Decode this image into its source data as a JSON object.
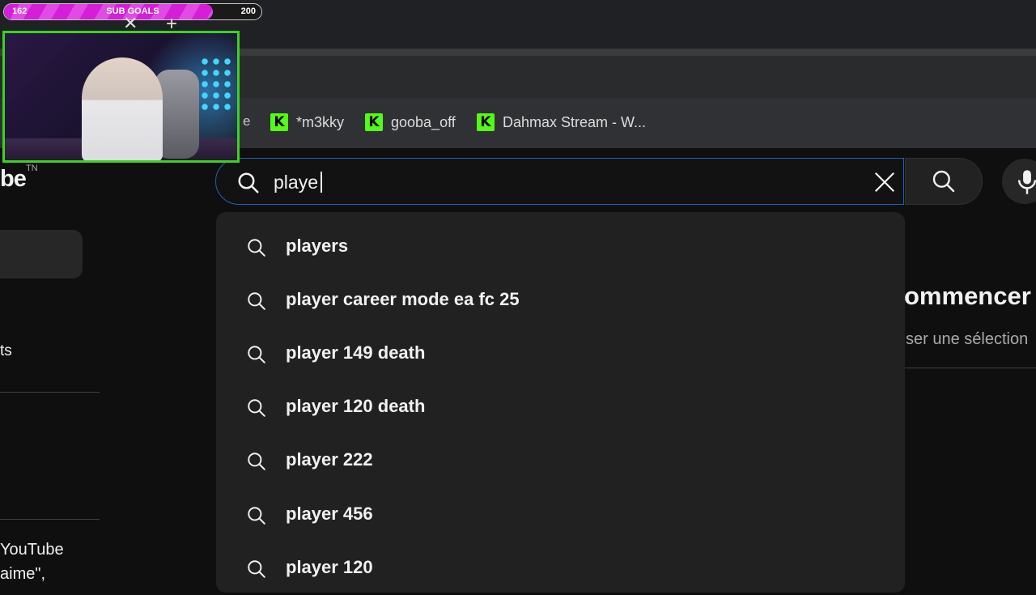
{
  "overlay": {
    "sub_goal": {
      "current": "162",
      "label": "SUB GOALS",
      "target": "200",
      "progress_fraction": 0.81
    },
    "close_glyph": "✕",
    "add_glyph": "+"
  },
  "bookmarks": {
    "partial_label": "e",
    "items": [
      {
        "label": "*m3kky",
        "icon": "kick-icon"
      },
      {
        "label": "gooba_off",
        "icon": "kick-icon"
      },
      {
        "label": "Dahmax Stream - W...",
        "icon": "kick-icon"
      }
    ],
    "icon_glyph": "K",
    "icon_color": "#53fc18"
  },
  "youtube": {
    "logo_fragment": "be",
    "logo_suffix": "TN",
    "search": {
      "value": "playe",
      "focus_color": "#1c62b9"
    },
    "suggestions": [
      "players",
      "player career mode ea fc 25",
      "player 149 death",
      "player 120 death",
      "player 222",
      "player 456",
      "player 120"
    ],
    "sidebar": {
      "partial_item": "ts",
      "footer_line1": "YouTube",
      "footer_line2": "aime\","
    },
    "main": {
      "title_fragment": "ommencer",
      "subtitle_fragment": "ser une sélection"
    }
  }
}
